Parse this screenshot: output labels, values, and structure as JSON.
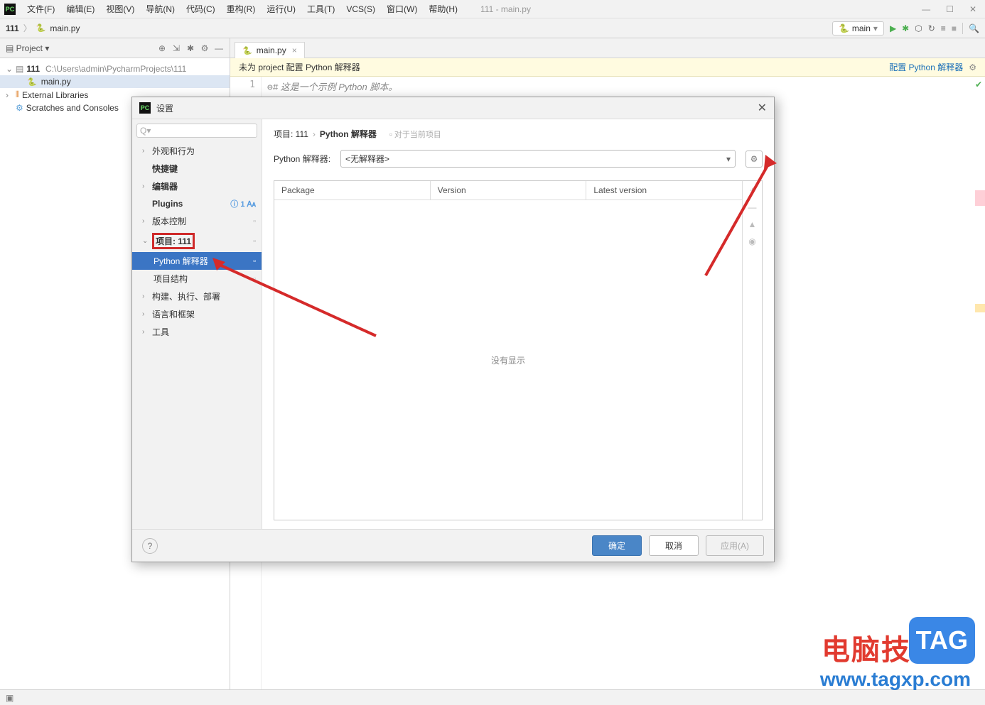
{
  "menubar": {
    "items": [
      "文件(F)",
      "编辑(E)",
      "视图(V)",
      "导航(N)",
      "代码(C)",
      "重构(R)",
      "运行(U)",
      "工具(T)",
      "VCS(S)",
      "窗口(W)",
      "帮助(H)"
    ],
    "window_title": "111 - main.py"
  },
  "navbar": {
    "project": "111",
    "file": "main.py",
    "run_config": "main"
  },
  "project_pane": {
    "title": "Project",
    "root": "111",
    "root_path": "C:\\Users\\admin\\PycharmProjects\\111",
    "file": "main.py",
    "ext_lib": "External Libraries",
    "scratches": "Scratches and Consoles"
  },
  "editor": {
    "tab": "main.py",
    "banner_text": "未为 project 配置 Python 解释器",
    "banner_action": "配置 Python 解释器",
    "line_num": "1",
    "code_comment": "# 这是一个示例 Python 脚本。"
  },
  "dialog": {
    "title": "设置",
    "search_placeholder": "Q▾",
    "tree": {
      "appearance": "外观和行为",
      "keymap": "快捷键",
      "editor": "编辑器",
      "plugins": "Plugins",
      "plugins_badge": "1",
      "vcs": "版本控制",
      "project": "项目: 111",
      "interpreter": "Python 解释器",
      "structure": "项目结构",
      "build": "构建、执行、部署",
      "lang": "语言和框架",
      "tools": "工具"
    },
    "content": {
      "crumb1": "项目: 111",
      "crumb2": "Python 解释器",
      "hint": "对于当前项目",
      "interp_label": "Python 解释器:",
      "interp_value": "<无解释器>",
      "col_package": "Package",
      "col_version": "Version",
      "col_latest": "Latest version",
      "empty": "没有显示"
    },
    "buttons": {
      "ok": "确定",
      "cancel": "取消",
      "apply": "应用(A)"
    }
  },
  "watermark": {
    "cn": "电脑技术网",
    "url": "www.tagxp.com",
    "tag": "TAG"
  }
}
